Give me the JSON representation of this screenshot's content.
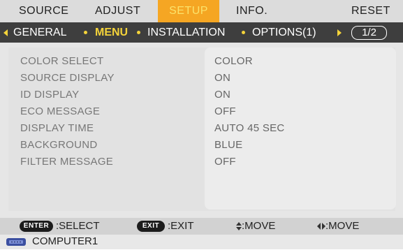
{
  "tabs": [
    {
      "label": "SOURCE"
    },
    {
      "label": "ADJUST"
    },
    {
      "label": "SETUP"
    },
    {
      "label": "INFO."
    },
    {
      "label": "RESET"
    }
  ],
  "subtabs": [
    {
      "label": "GENERAL"
    },
    {
      "label": "MENU"
    },
    {
      "label": "INSTALLATION"
    },
    {
      "label": "OPTIONS(1)"
    }
  ],
  "page_indicator": "1/2",
  "settings": [
    {
      "label": "COLOR SELECT",
      "value": "COLOR"
    },
    {
      "label": "SOURCE DISPLAY",
      "value": "ON"
    },
    {
      "label": "ID DISPLAY",
      "value": "ON"
    },
    {
      "label": "ECO MESSAGE",
      "value": "OFF"
    },
    {
      "label": "DISPLAY TIME",
      "value": "AUTO 45 SEC"
    },
    {
      "label": "BACKGROUND",
      "value": "BLUE"
    },
    {
      "label": "FILTER MESSAGE",
      "value": "OFF"
    }
  ],
  "footer": {
    "enter_key": "ENTER",
    "enter_text": ":SELECT",
    "exit_key": "EXIT",
    "exit_text": ":EXIT",
    "ud_text": ":MOVE",
    "lr_text": ":MOVE"
  },
  "status": {
    "source": "COMPUTER1",
    "icon": "computer-input-icon"
  },
  "colors": {
    "active_tab": "#f5a623",
    "active_subtab": "#f4d33a",
    "subtab_bar": "#3e3e3e"
  }
}
